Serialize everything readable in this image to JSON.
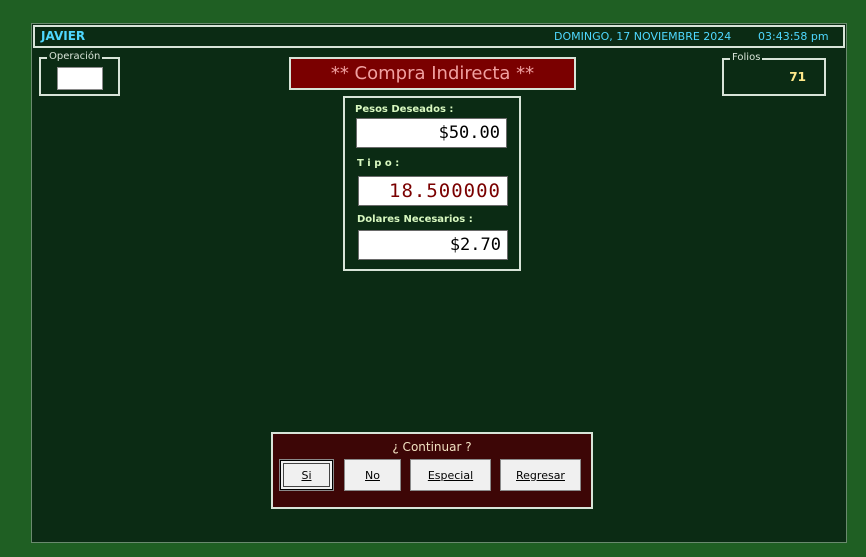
{
  "header": {
    "user": "JAVIER",
    "date": "DOMINGO, 17  NOVIEMBRE 2024",
    "time": "03:43:58 pm"
  },
  "operacion": {
    "label": "Operación",
    "value": ""
  },
  "folios": {
    "label": "Folios",
    "value": "71"
  },
  "banner": {
    "title": "** Compra Indirecta **"
  },
  "panel": {
    "pesos_label": "Pesos Deseados :",
    "pesos_value": "$50.00",
    "tipo_label": "T i p o :",
    "tipo_value": "18.500000",
    "dolares_label": "Dolares Necesarios :",
    "dolares_value": "$2.70"
  },
  "dialog": {
    "prompt": "¿ Continuar ?",
    "buttons": {
      "si": "Si",
      "no": "No",
      "especial": "Especial",
      "regresar": "Regresar"
    }
  },
  "colors": {
    "background": "#1f5f23",
    "window": "#0b2b14",
    "banner": "#7a0000",
    "dialog": "#3d0606",
    "accent_cyan": "#4fd8ff"
  }
}
